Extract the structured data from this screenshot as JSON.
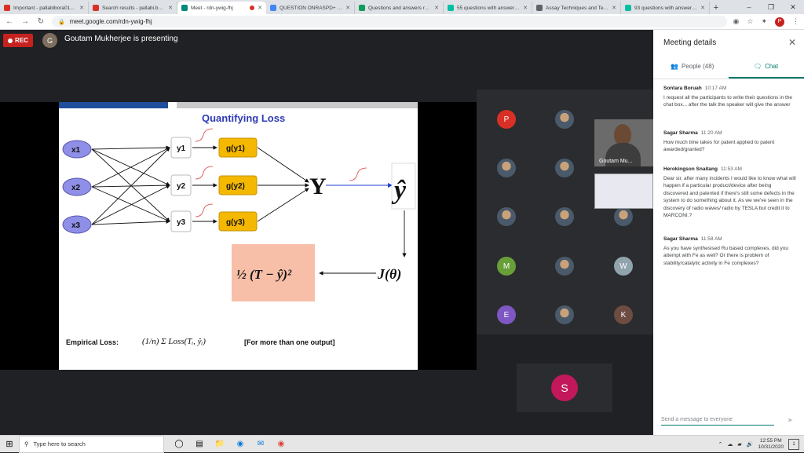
{
  "browser": {
    "tabs": [
      {
        "title": "Important - pallabibora01...",
        "color": "#d93025"
      },
      {
        "title": "Search results - pallabi.bo...",
        "color": "#d93025"
      },
      {
        "title": "Meet - rdn-ywig-fhj",
        "color": "#00897b",
        "active": true
      },
      {
        "title": "QUESTION ONRASPD+ in ...",
        "color": "#4285f4"
      },
      {
        "title": "Questions and answers reg...",
        "color": "#0f9d58"
      },
      {
        "title": "55 questions with answers...",
        "color": "#00bfa5"
      },
      {
        "title": "Assay Techniques and Test...",
        "color": "#5f6368"
      },
      {
        "title": "93 questions with answers...",
        "color": "#00bfa5"
      }
    ],
    "url": "meet.google.com/rdn-ywig-fhj",
    "profile_initial": "P"
  },
  "meet": {
    "rec_label": "REC",
    "presenter_initial": "G",
    "presenting_text": "Goutam Mukherjee is presenting",
    "self_name": "Goutam Mu...",
    "participants": [
      {
        "initial": "P",
        "color": "#d93025"
      },
      {
        "initial": "",
        "color": "#8e6b5a",
        "photo": true
      },
      {
        "initial": "",
        "color": "#7c8a9a",
        "photo": true
      },
      {
        "initial": "",
        "color": "#c0506a",
        "photo": true
      },
      {
        "initial": "",
        "color": "#5a6a7a",
        "photo": true
      },
      {
        "initial": "",
        "color": "#6a5a4a",
        "photo": true
      },
      {
        "initial": "",
        "color": "#7a5a4a",
        "photo": true
      },
      {
        "initial": "M",
        "color": "#689f38"
      },
      {
        "initial": "",
        "color": "#7a9a5a",
        "photo": true
      },
      {
        "initial": "W",
        "color": "#90a4ae"
      },
      {
        "initial": "E",
        "color": "#7e57c2"
      },
      {
        "initial": "",
        "color": "#5a4a3a",
        "photo": true
      },
      {
        "initial": "K",
        "color": "#6d4c41"
      }
    ],
    "lone_participant": {
      "initial": "S",
      "color": "#c2185b"
    }
  },
  "slide": {
    "title": "Quantifying Loss",
    "inputs": [
      "x1",
      "x2",
      "x3"
    ],
    "hidden": [
      "y1",
      "y2",
      "y3"
    ],
    "activations": [
      "g(y1)",
      "g(y2)",
      "g(y3)"
    ],
    "output_symbol": "Y",
    "target_symbol": "ŷ",
    "loss_expr": "½ (T − ŷ)²",
    "objective": "J(θ)",
    "empirical_label": "Empirical Loss:",
    "empirical_expr": "(1/n) Σ Loss(Tᵢ, ŷᵢ)",
    "note": "[For more than one output]"
  },
  "panel": {
    "title": "Meeting details",
    "tabs": {
      "people": "People (48)",
      "chat": "Chat"
    },
    "messages": [
      {
        "name": "Sontara Boruah",
        "time": "10:17 AM",
        "text": "I request all the participants to write their questions in the chat box... after the talk the speaker will give the answer"
      },
      {
        "name": "Sagar Sharma",
        "time": "11:20 AM",
        "text": "How much time takes for patent applied to patent awarded/granted?"
      },
      {
        "name": "Herokingson Snaitang",
        "time": "11:53 AM",
        "text": "Dear sir, after many incidents I would like to know what will happen if a particular product/device after being discovered and patented if there's still some defects in the system to do something about it. As we we've seen in the discovery of radio waves/ radio by TESLA but credit it to MARCONI.?"
      },
      {
        "name": "Sagar Sharma",
        "time": "11:58 AM",
        "text": "As you have synthesised Ru based complexes, did you attempt with Fe as well? Or there is problem of stability/catalytic activity in Fe complexes?"
      }
    ],
    "compose_placeholder": "Send a message to everyone"
  },
  "taskbar": {
    "search_placeholder": "Type here to search",
    "time": "12:55 PM",
    "date": "10/31/2020",
    "notifications": "1"
  }
}
